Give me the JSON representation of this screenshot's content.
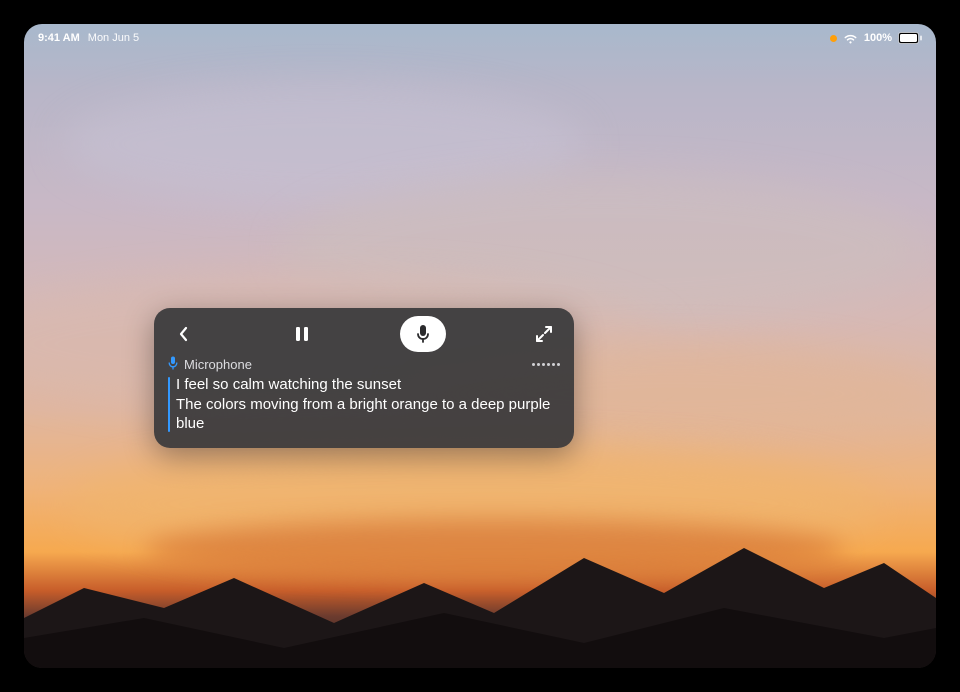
{
  "statusbar": {
    "time": "9:41 AM",
    "date": "Mon Jun 5",
    "battery_percent": "100%"
  },
  "captions_panel": {
    "source_label": "Microphone",
    "line1": "I feel so calm watching the sunset",
    "line2": "The colors moving from a bright orange to a deep purple blue"
  }
}
